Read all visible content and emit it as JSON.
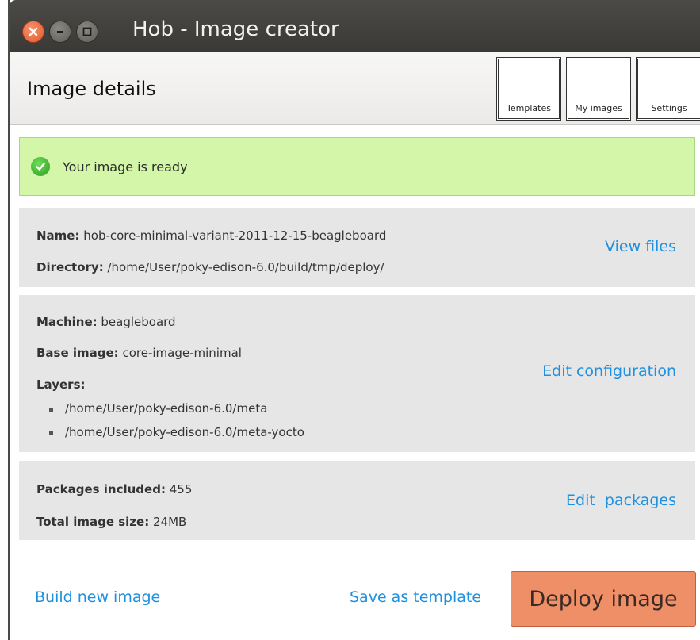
{
  "window": {
    "title": "Hob - Image creator",
    "controls": {
      "close": "close-icon",
      "minimize": "minimize-icon",
      "maximize": "maximize-icon"
    }
  },
  "header": {
    "title": "Image details",
    "toolbar": [
      {
        "label": "Templates"
      },
      {
        "label": "My images"
      },
      {
        "label": "Settings"
      }
    ]
  },
  "banner": {
    "icon": "checkmark-icon",
    "text": "Your image is ready",
    "color": "#d3f6a8"
  },
  "image_info": {
    "name_label": "Name:",
    "name_value": "hob-core-minimal-variant-2011-12-15-beagleboard",
    "directory_label": "Directory:",
    "directory_value": "/home/User/poky-edison-6.0/build/tmp/deploy/",
    "action": "View files"
  },
  "configuration": {
    "machine_label": "Machine:",
    "machine_value": "beagleboard",
    "base_image_label": "Base image:",
    "base_image_value": "core-image-minimal",
    "layers_label": "Layers:",
    "layers": [
      "/home/User/poky-edison-6.0/meta",
      "/home/User/poky-edison-6.0/meta-yocto"
    ],
    "action": "Edit configuration"
  },
  "packages": {
    "included_label": "Packages included:",
    "included_value": "455",
    "size_label": "Total image size:",
    "size_value": "24MB",
    "action": "Edit  packages"
  },
  "footer": {
    "build_new": "Build new image",
    "save_template": "Save as template",
    "deploy": "Deploy image"
  },
  "colors": {
    "link": "#1e90e0",
    "deploy_button": "#ef8f68",
    "section_bg": "#e6e6e6"
  }
}
